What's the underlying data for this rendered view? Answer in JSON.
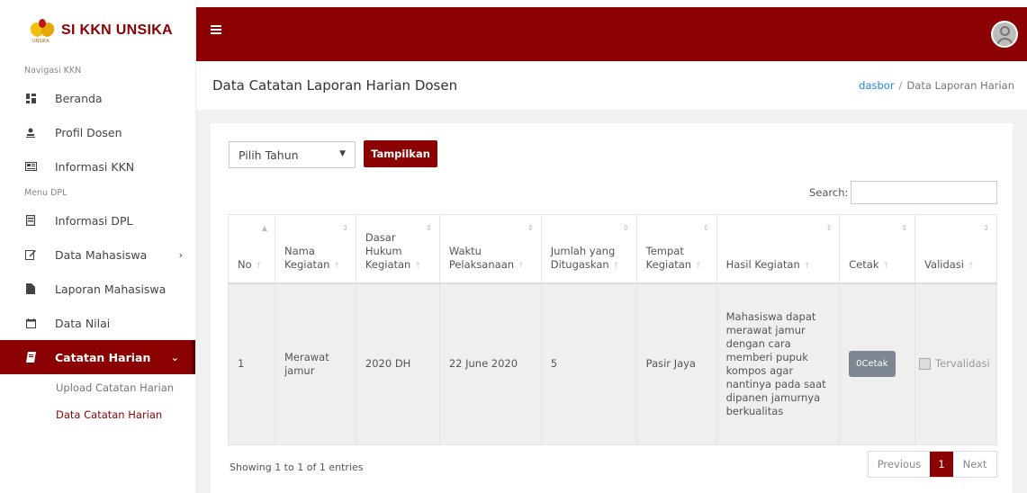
{
  "sidebar": {
    "brand": "SI KKN UNSIKA",
    "logo_caption": "UNSIKA",
    "sections": {
      "nav": "Navigasi KKN",
      "menu": "Menu DPL"
    },
    "items": [
      {
        "label": "Beranda",
        "icon": "dashboard-icon"
      },
      {
        "label": "Profil Dosen",
        "icon": "user-icon"
      },
      {
        "label": "Informasi KKN",
        "icon": "newspaper-icon"
      },
      {
        "label": "Informasi DPL",
        "icon": "book-icon"
      },
      {
        "label": "Data Mahasiswa",
        "icon": "edit-icon"
      },
      {
        "label": "Laporan Mahasiswa",
        "icon": "file-icon"
      },
      {
        "label": "Data Nilai",
        "icon": "calendar-icon"
      },
      {
        "label": "Catatan Harian",
        "icon": "book-icon"
      }
    ],
    "sub_items": [
      {
        "label": "Upload Catatan Harian"
      },
      {
        "label": "Data Catatan Harian"
      }
    ]
  },
  "header": {
    "title": "Data Catatan Laporan Harian Dosen",
    "breadcrumb_link": "dasbor",
    "breadcrumb_sep": "/",
    "breadcrumb_current": "Data Laporan Harian"
  },
  "filter": {
    "year_select": "Pilih Tahun",
    "show_button": "Tampilkan",
    "search_label": "Search:"
  },
  "table": {
    "headers": [
      "No",
      "Nama Kegiatan",
      "Dasar Hukum Kegiatan",
      "Waktu Pelaksanaan",
      "Jumlah yang Ditugaskan",
      "Tempat Kegiatan",
      "Hasil Kegiatan",
      "Cetak",
      "Validasi"
    ],
    "rows": [
      {
        "no": "1",
        "nama": "Merawat jamur",
        "dasar": "2020 DH",
        "waktu": "22 June 2020",
        "jumlah": "5",
        "tempat": "Pasir Jaya",
        "hasil": "Mahasiswa dapat merawat jamur dengan cara memberi pupuk kompos agar nantinya pada saat dipanen jamurnya berkualitas",
        "cetak": "0Cetak",
        "validasi": "Tervalidasi"
      }
    ]
  },
  "footer": {
    "info": "Showing 1 to 1 of 1 entries",
    "prev": "Previous",
    "page": "1",
    "next": "Next"
  },
  "colors": {
    "primary": "#8b0000",
    "link": "#1e88e5"
  }
}
